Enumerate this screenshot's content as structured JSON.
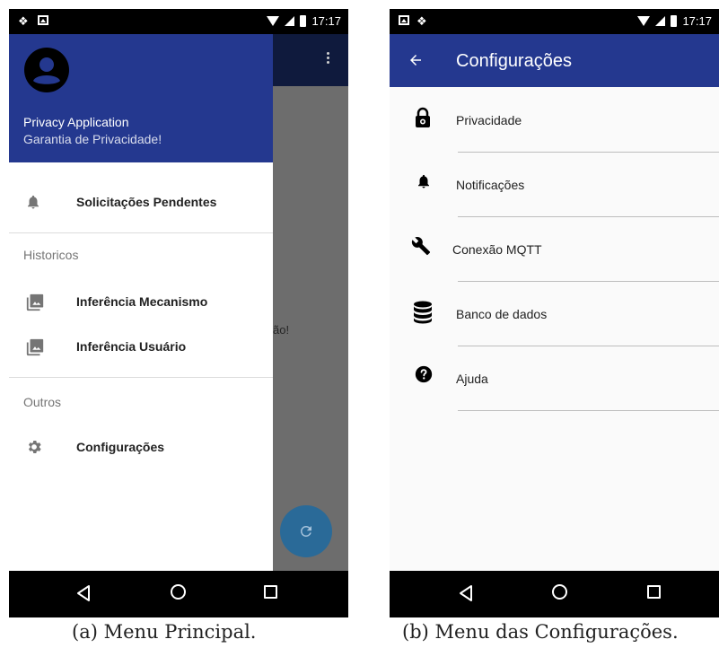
{
  "status_bar": {
    "time": "17:17"
  },
  "main_menu": {
    "background_text": "ão!",
    "drawer": {
      "app_name": "Privacy Application",
      "tagline": "Garantia de Privacidade!",
      "pending": "Solicitações Pendentes",
      "section_historicos": "Historicos",
      "history_items": [
        "Inferência Mecanismo",
        "Inferência Usuário"
      ],
      "section_outros": "Outros",
      "settings": "Configurações"
    }
  },
  "settings_menu": {
    "title": "Configurações",
    "items": [
      {
        "label": "Privacidade",
        "icon": "lock-icon"
      },
      {
        "label": "Notificações",
        "icon": "bell-icon"
      },
      {
        "label": "Conexão MQTT",
        "icon": "wrench-icon"
      },
      {
        "label": "Banco de dados",
        "icon": "database-icon"
      },
      {
        "label": "Ajuda",
        "icon": "help-icon"
      }
    ]
  },
  "captions": {
    "a": "(a) Menu Principal.",
    "b": "(b) Menu das Configurações."
  },
  "colors": {
    "header_blue": "#24388f",
    "appbar_dark": "#0f1a3d",
    "fab": "#2a6a98",
    "scrim": "#6d6d6d"
  }
}
